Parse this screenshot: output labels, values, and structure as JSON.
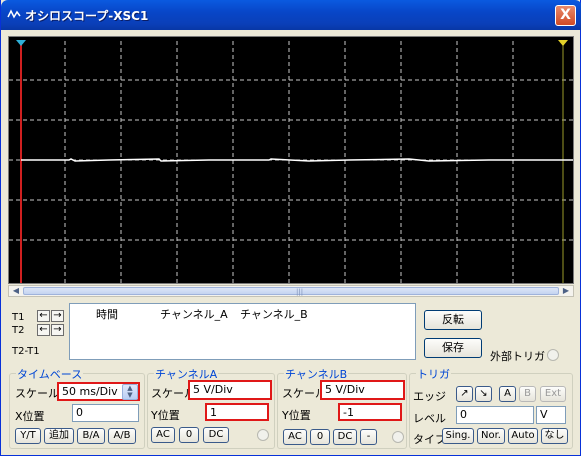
{
  "window": {
    "title": "オシロスコープ-XSC1",
    "close_label": "X"
  },
  "cursors": {
    "t1_label": "T1",
    "t2_label": "T2",
    "t2t1_label": "T2-T1",
    "left_arrow": "←",
    "right_arrow": "→"
  },
  "readout": {
    "columns": [
      "時間",
      "チャンネル_A",
      "チャンネル_B"
    ]
  },
  "side": {
    "reverse_label": "反転",
    "save_label": "保存",
    "ext_trigger_label": "外部トリガ"
  },
  "timebase": {
    "title": "タイムベース",
    "scale_label": "スケール",
    "scale_value": "50 ms/Div",
    "xpos_label": "X位置",
    "xpos_value": "0",
    "buttons": [
      "Y/T",
      "追加",
      "B/A",
      "A/B"
    ]
  },
  "channel_a": {
    "title": "チャンネルA",
    "scale_label": "スケール",
    "scale_value": "5  V/Div",
    "ypos_label": "Y位置",
    "ypos_value": "1",
    "buttons": [
      "AC",
      "0",
      "DC"
    ]
  },
  "channel_b": {
    "title": "チャンネルB",
    "scale_label": "スケール",
    "scale_value": "5  V/Div",
    "ypos_label": "Y位置",
    "ypos_value": "-1",
    "buttons": [
      "AC",
      "0",
      "DC",
      "-"
    ]
  },
  "trigger": {
    "title": "トリガ",
    "edge_label": "エッジ",
    "edge_rise": "↗",
    "edge_fall": "↘",
    "src_buttons": [
      "A",
      "B",
      "Ext"
    ],
    "level_label": "レベル",
    "level_value": "0",
    "level_unit": "V",
    "type_label": "タイプ",
    "type_buttons": [
      "Sing.",
      "Nor.",
      "Auto",
      "なし"
    ]
  },
  "colors": {
    "title_bar": "#0a4fd8",
    "screen_bg": "#000000",
    "grid": "#c8c8c8",
    "trace": "#ffffff",
    "cursor1": "#d02020",
    "highlight": "#e01818"
  }
}
